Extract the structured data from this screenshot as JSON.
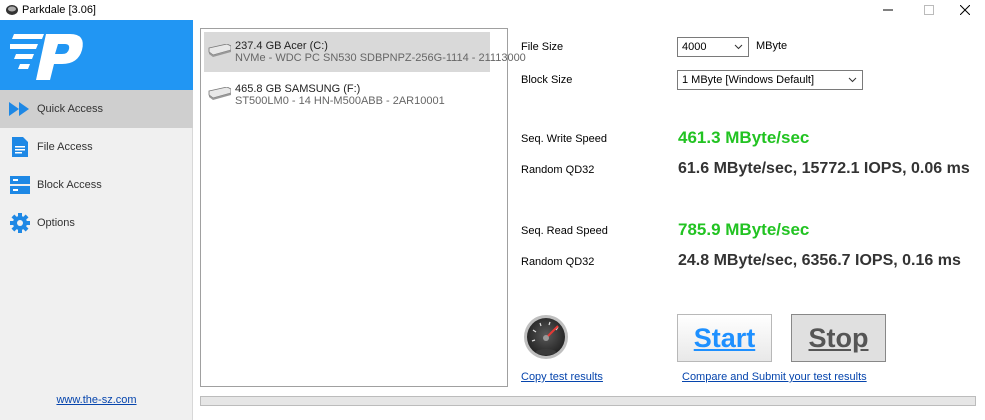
{
  "window": {
    "title": "Parkdale [3.06]"
  },
  "sidebar": {
    "items": [
      {
        "label": "Quick Access",
        "icon": "play-forward-icon",
        "active": true
      },
      {
        "label": "File Access",
        "icon": "document-icon"
      },
      {
        "label": "Block Access",
        "icon": "server-icon"
      },
      {
        "label": "Options",
        "icon": "gear-icon"
      }
    ],
    "website": "www.the-sz.com",
    "brand_color": "#2196f3"
  },
  "drives": [
    {
      "name": "237.4 GB Acer (C:)",
      "detail": "NVMe - WDC PC SN530 SDBPNPZ-256G-1114 - 21113000",
      "selected": true
    },
    {
      "name": "465.8 GB SAMSUNG (F:)",
      "detail": "ST500LM0 - 14 HN-M500ABB - 2AR10001"
    }
  ],
  "settings": {
    "file_size_label": "File Size",
    "file_size_value": "4000",
    "file_size_unit": "MByte",
    "block_size_label": "Block Size",
    "block_size_value": "1 MByte [Windows Default]"
  },
  "results": {
    "write_label": "Seq. Write Speed",
    "write_value": "461.3 MByte/sec",
    "write_random_label": "Random QD32",
    "write_random_value": "61.6 MByte/sec, 15772.1 IOPS, 0.06 ms",
    "read_label": "Seq. Read Speed",
    "read_value": "785.9 MByte/sec",
    "read_random_label": "Random QD32",
    "read_random_value": "24.8 MByte/sec, 6356.7 IOPS, 0.16 ms"
  },
  "actions": {
    "start_label": "Start",
    "stop_label": "Stop",
    "copy_link": "Copy test results",
    "compare_link": "Compare and Submit your test results"
  },
  "progress": {
    "fraction": 0.0
  },
  "colors": {
    "speed_green": "#22c322",
    "link_blue": "#0645ad",
    "start_blue": "#1e90ff"
  }
}
